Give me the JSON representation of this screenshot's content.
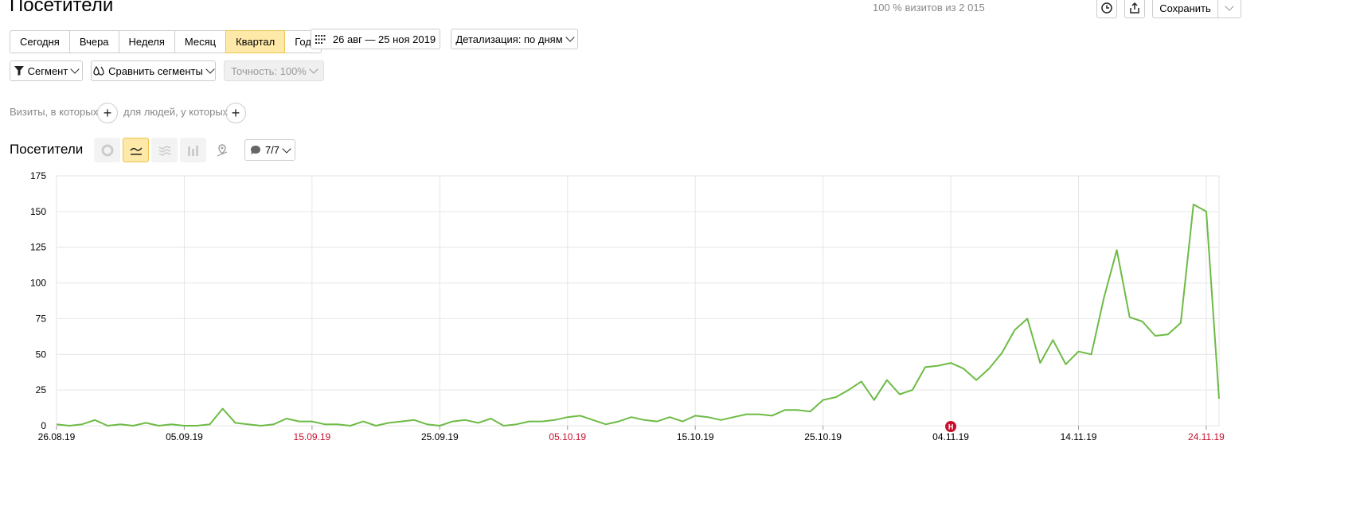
{
  "header": {
    "title": "Посетители",
    "visits_info": "100 % визитов из 2 015",
    "save_label": "Сохранить"
  },
  "periods": [
    {
      "label": "Сегодня",
      "active": false
    },
    {
      "label": "Вчера",
      "active": false
    },
    {
      "label": "Неделя",
      "active": false
    },
    {
      "label": "Месяц",
      "active": false
    },
    {
      "label": "Квартал",
      "active": true
    },
    {
      "label": "Год",
      "active": false
    }
  ],
  "date_range": "26 авг — 25 ноя 2019",
  "detail": "Детализация: по дням",
  "segment_label": "Сегмент",
  "compare_label": "Сравнить сегменты",
  "accuracy_label": "Точность: 100%",
  "filter": {
    "visits_label": "Визиты, в которых",
    "people_label": "для людей, у которых"
  },
  "chart_section": {
    "title": "Посетители",
    "annotations_count": "7/7"
  },
  "colors": {
    "line": "#6dbb45",
    "holiday": "#c8102e",
    "active_bg": "#ffe9a8"
  },
  "chart_data": {
    "type": "line",
    "title": "",
    "xlabel": "",
    "ylabel": "",
    "ylim": [
      0,
      175
    ],
    "yticks": [
      0,
      25,
      50,
      75,
      100,
      125,
      150,
      175
    ],
    "xtick_labels": [
      {
        "label": "26.08.19",
        "index": 0,
        "holiday": false
      },
      {
        "label": "05.09.19",
        "index": 10,
        "holiday": false
      },
      {
        "label": "15.09.19",
        "index": 20,
        "holiday": true
      },
      {
        "label": "25.09.19",
        "index": 30,
        "holiday": false
      },
      {
        "label": "05.10.19",
        "index": 40,
        "holiday": true
      },
      {
        "label": "15.10.19",
        "index": 50,
        "holiday": false
      },
      {
        "label": "25.10.19",
        "index": 60,
        "holiday": false
      },
      {
        "label": "04.11.19",
        "index": 70,
        "holiday": false
      },
      {
        "label": "14.11.19",
        "index": 80,
        "holiday": false
      },
      {
        "label": "24.11.19",
        "index": 90,
        "holiday": true
      }
    ],
    "marker": {
      "label": "Н",
      "index": 70
    },
    "series": [
      {
        "values": [
          1,
          0,
          1,
          4,
          0,
          1,
          0,
          2,
          0,
          1,
          0,
          0,
          1,
          12,
          2,
          1,
          0,
          1,
          5,
          3,
          3,
          1,
          1,
          0,
          3,
          0,
          2,
          3,
          4,
          1,
          0,
          3,
          4,
          2,
          5,
          0,
          1,
          3,
          3,
          4,
          6,
          7,
          4,
          1,
          3,
          6,
          4,
          3,
          6,
          3,
          7,
          6,
          4,
          6,
          8,
          8,
          7,
          11,
          11,
          10,
          18,
          20,
          25,
          31,
          18,
          32,
          22,
          25,
          41,
          42,
          44,
          40,
          32,
          40,
          51,
          67,
          75,
          44,
          60,
          43,
          52,
          50,
          90,
          123,
          76,
          73,
          63,
          64,
          72,
          155,
          150,
          19
        ]
      }
    ]
  }
}
